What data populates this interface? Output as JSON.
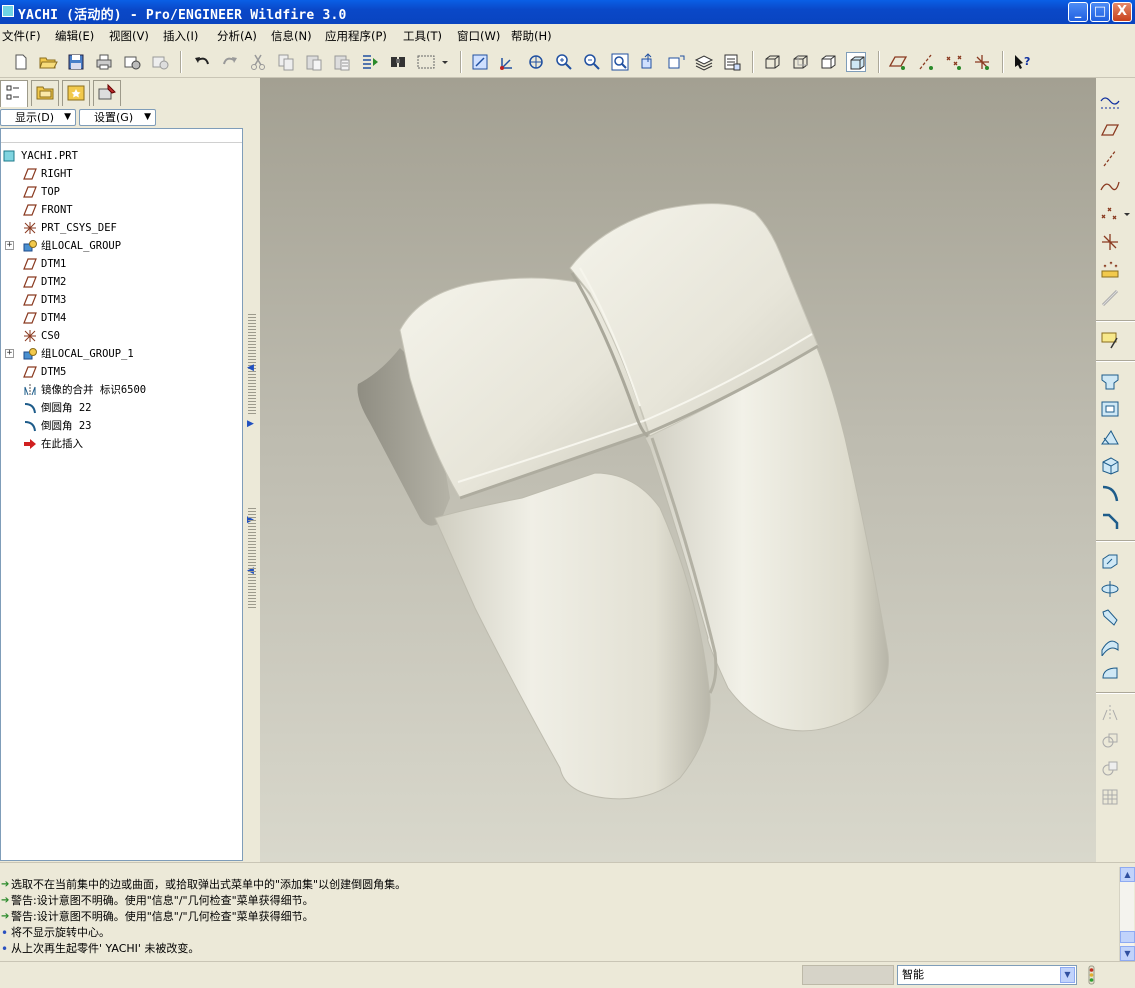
{
  "window": {
    "title": "YACHI (活动的) - Pro/ENGINEER Wildfire 3.0",
    "min_label": "_",
    "max_label": "□",
    "close_label": "X"
  },
  "menu": {
    "items": [
      "文件(F)",
      "编辑(E)",
      "视图(V)",
      "插入(I)",
      "分析(A)",
      "信息(N)",
      "应用程序(P)",
      "工具(T)",
      "窗口(W)",
      "帮助(H)"
    ]
  },
  "toolbar": {
    "icons": [
      "new-file",
      "open-file",
      "save",
      "print",
      "email",
      "email-link",
      "undo",
      "redo",
      "cut",
      "copy",
      "paste",
      "paste-special",
      "regenerate",
      "find",
      "select-box",
      "repaint",
      "spin-center",
      "orient",
      "zoom-in",
      "zoom-out",
      "refit",
      "reorient",
      "saved-views",
      "layers",
      "view-manager",
      "wireframe",
      "hidden-line",
      "no-hidden",
      "shading",
      "datum-planes",
      "datum-axes",
      "datum-points",
      "coordinate-systems",
      "context-help"
    ]
  },
  "left_panel": {
    "show_label": "显示(D)",
    "settings_label": "设置(G)",
    "tree": [
      {
        "label": "YACHI.PRT",
        "type": "part",
        "indent": 0
      },
      {
        "label": "RIGHT",
        "type": "plane",
        "indent": 1
      },
      {
        "label": "TOP",
        "type": "plane",
        "indent": 1
      },
      {
        "label": "FRONT",
        "type": "plane",
        "indent": 1
      },
      {
        "label": "PRT_CSYS_DEF",
        "type": "csys",
        "indent": 1
      },
      {
        "label": "组LOCAL_GROUP",
        "type": "group",
        "indent": 1,
        "expandable": true
      },
      {
        "label": "DTM1",
        "type": "plane",
        "indent": 1
      },
      {
        "label": "DTM2",
        "type": "plane",
        "indent": 1
      },
      {
        "label": "DTM3",
        "type": "plane",
        "indent": 1
      },
      {
        "label": "DTM4",
        "type": "plane",
        "indent": 1
      },
      {
        "label": "CS0",
        "type": "csys",
        "indent": 1
      },
      {
        "label": "组LOCAL_GROUP_1",
        "type": "group",
        "indent": 1,
        "expandable": true
      },
      {
        "label": "DTM5",
        "type": "plane",
        "indent": 1
      },
      {
        "label": "镜像的合并 标识6500",
        "type": "mirror",
        "indent": 1
      },
      {
        "label": "倒圆角 22",
        "type": "round",
        "indent": 1
      },
      {
        "label": "倒圆角 23",
        "type": "round",
        "indent": 1
      },
      {
        "label": "在此插入",
        "type": "insert",
        "indent": 1
      }
    ]
  },
  "messages": [
    {
      "icon": "arrow",
      "text": "选取不在当前集中的边或曲面，或拾取弹出式菜单中的\"添加集\"以创建倒圆角集。"
    },
    {
      "icon": "arrow",
      "text": "警告:设计意图不明确。使用\"信息\"/\"几何检查\"菜单获得细节。"
    },
    {
      "icon": "arrow",
      "text": "警告:设计意图不明确。使用\"信息\"/\"几何检查\"菜单获得细节。"
    },
    {
      "icon": "dot",
      "text": "将不显示旋转中心。"
    },
    {
      "icon": "dot",
      "text": "从上次再生起零件' YACHI' 未被改变。"
    }
  ],
  "status": {
    "filter_value": "智能"
  },
  "colors": {
    "title_bar": "#0a48c8",
    "model_surface": "#e6e4d8",
    "viewport_top": "#a3a092",
    "viewport_bottom": "#d9d8cc"
  }
}
